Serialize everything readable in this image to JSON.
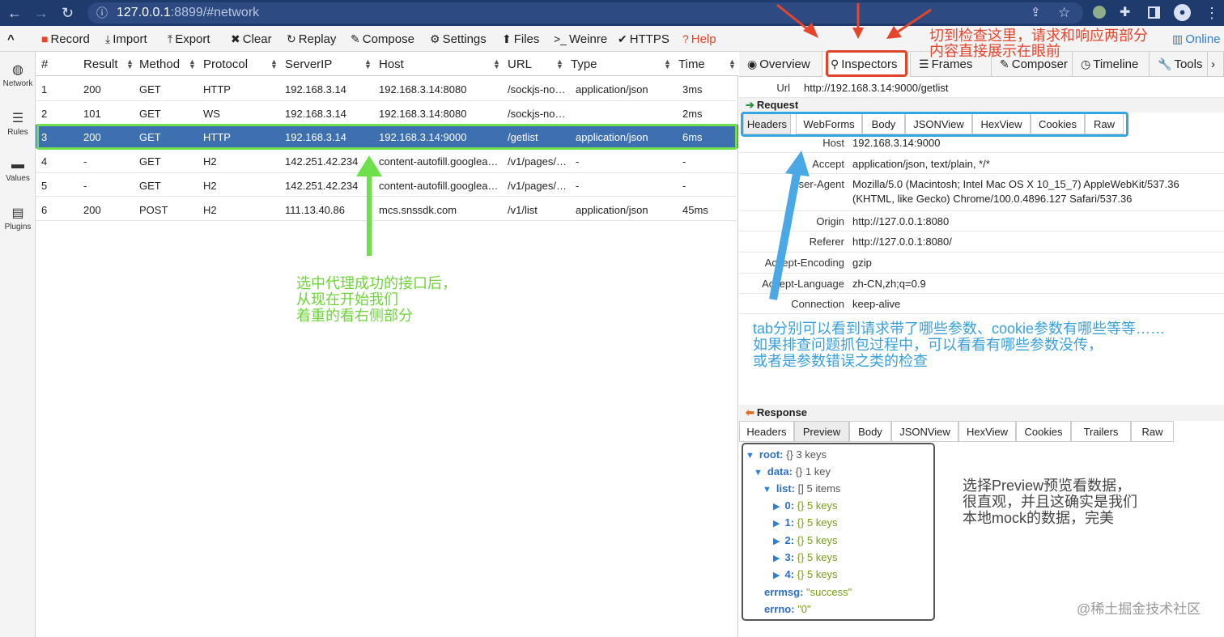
{
  "browser": {
    "url_host": "127.0.0.1",
    "url_rest": ":8899/#network",
    "icons": [
      "back-arrow-icon",
      "forward-arrow-icon",
      "reload-icon",
      "info-icon",
      "share-icon",
      "star-icon",
      "profile-dot-icon",
      "extensions-icon",
      "sidebar-icon",
      "account-icon",
      "menu-dots-icon"
    ]
  },
  "toolbar": {
    "collapse": "^",
    "record": "Record",
    "import": "Import",
    "export": "Export",
    "clear": "Clear",
    "replay": "Replay",
    "compose": "Compose",
    "settings": "Settings",
    "files": "Files",
    "weinre": "Weinre",
    "https": "HTTPS",
    "help": "Help",
    "online": "Online"
  },
  "sidebar": {
    "items": [
      {
        "label": "Network",
        "icon": "globe-icon"
      },
      {
        "label": "Rules",
        "icon": "list-icon"
      },
      {
        "label": "Values",
        "icon": "folder-icon"
      },
      {
        "label": "Plugins",
        "icon": "document-icon"
      }
    ]
  },
  "table": {
    "columns": [
      "#",
      "Result",
      "Method",
      "Protocol",
      "ServerIP",
      "Host",
      "URL",
      "Type",
      "Time"
    ],
    "rows": [
      {
        "num": "1",
        "result": "200",
        "method": "GET",
        "protocol": "HTTP",
        "ip": "192.168.3.14",
        "host": "192.168.3.14:8080",
        "url": "/sockjs-no…",
        "type": "application/json",
        "time": "3ms"
      },
      {
        "num": "2",
        "result": "101",
        "method": "GET",
        "protocol": "WS",
        "ip": "192.168.3.14",
        "host": "192.168.3.14:8080",
        "url": "/sockjs-no…",
        "type": "",
        "time": "2ms"
      },
      {
        "num": "3",
        "result": "200",
        "method": "GET",
        "protocol": "HTTP",
        "ip": "192.168.3.14",
        "host": "192.168.3.14:9000",
        "url": "/getlist",
        "type": "application/json",
        "time": "6ms"
      },
      {
        "num": "4",
        "result": "-",
        "method": "GET",
        "protocol": "H2",
        "ip": "142.251.42.234",
        "host": "content-autofill.googlea…",
        "url": "/v1/pages/…",
        "type": "-",
        "time": "-"
      },
      {
        "num": "5",
        "result": "-",
        "method": "GET",
        "protocol": "H2",
        "ip": "142.251.42.234",
        "host": "content-autofill.googlea…",
        "url": "/v1/pages/…",
        "type": "-",
        "time": "-"
      },
      {
        "num": "6",
        "result": "200",
        "method": "POST",
        "protocol": "H2",
        "ip": "111.13.40.86",
        "host": "mcs.snssdk.com",
        "url": "/v1/list",
        "type": "application/json",
        "time": "45ms"
      }
    ]
  },
  "inspector": {
    "tabs": [
      "Overview",
      "Inspectors",
      "Frames",
      "Composer",
      "Timeline",
      "Tools"
    ],
    "url_label": "Url",
    "url_value": "http://192.168.3.14:9000/getlist",
    "request_title": "Request",
    "request_tabs": [
      "Headers",
      "WebForms",
      "Body",
      "JSONView",
      "HexView",
      "Cookies",
      "Raw"
    ],
    "headers": [
      {
        "k": "Host",
        "v": "192.168.3.14:9000"
      },
      {
        "k": "Accept",
        "v": "application/json, text/plain, */*"
      },
      {
        "k": "User-Agent",
        "v": "Mozilla/5.0 (Macintosh; Intel Mac OS X 10_15_7) AppleWebKit/537.36 (KHTML, like Gecko) Chrome/100.0.4896.127 Safari/537.36"
      },
      {
        "k": "Origin",
        "v": "http://127.0.0.1:8080"
      },
      {
        "k": "Referer",
        "v": "http://127.0.0.1:8080/"
      },
      {
        "k": "Accept-Encoding",
        "v": "gzip"
      },
      {
        "k": "Accept-Language",
        "v": "zh-CN,zh;q=0.9"
      },
      {
        "k": "Connection",
        "v": "keep-alive"
      }
    ],
    "response_title": "Response",
    "response_tabs": [
      "Headers",
      "Preview",
      "Body",
      "JSONView",
      "HexView",
      "Cookies",
      "Trailers",
      "Raw"
    ],
    "tree": {
      "root_key": "root:",
      "root_brace": "{}",
      "root_cnt": "3 keys",
      "data_key": "data:",
      "data_brace": "{}",
      "data_cnt": "1 key",
      "list_key": "list:",
      "list_brace": "[]",
      "list_cnt": "5 items",
      "items": [
        {
          "key": "0:",
          "brace": "{}",
          "cnt": "5 keys"
        },
        {
          "key": "1:",
          "brace": "{}",
          "cnt": "5 keys"
        },
        {
          "key": "2:",
          "brace": "{}",
          "cnt": "5 keys"
        },
        {
          "key": "3:",
          "brace": "{}",
          "cnt": "5 keys"
        },
        {
          "key": "4:",
          "brace": "{}",
          "cnt": "5 keys"
        }
      ],
      "errmsg_key": "errmsg:",
      "errmsg_val": "\"success\"",
      "errno_key": "errno:",
      "errno_val": "\"0\""
    }
  },
  "annotations": {
    "green": [
      "选中代理成功的接口后，",
      "从现在开始我们",
      "着重的看右侧部分"
    ],
    "red": [
      "切到检查这里，请求和响应两部分",
      "内容直接展示在眼前"
    ],
    "blue": [
      "tab分别可以看到请求带了哪些参数、cookie参数有哪些等等……",
      "如果排查问题抓包过程中，可以看看有哪些参数没传，",
      "或者是参数错误之类的检查"
    ],
    "gray": [
      "选择Preview预览看数据，",
      "很直观，并且这确实是我们",
      "本地mock的数据，完美"
    ],
    "watermark": "@稀土掘金技术社区"
  },
  "colors": {
    "browser_bar": "#1f3a6d",
    "selected_row": "#3e6fb0",
    "green_annotation": "#6ed43a",
    "red_annotation": "#e5452b",
    "blue_annotation": "#3aa0dc"
  }
}
